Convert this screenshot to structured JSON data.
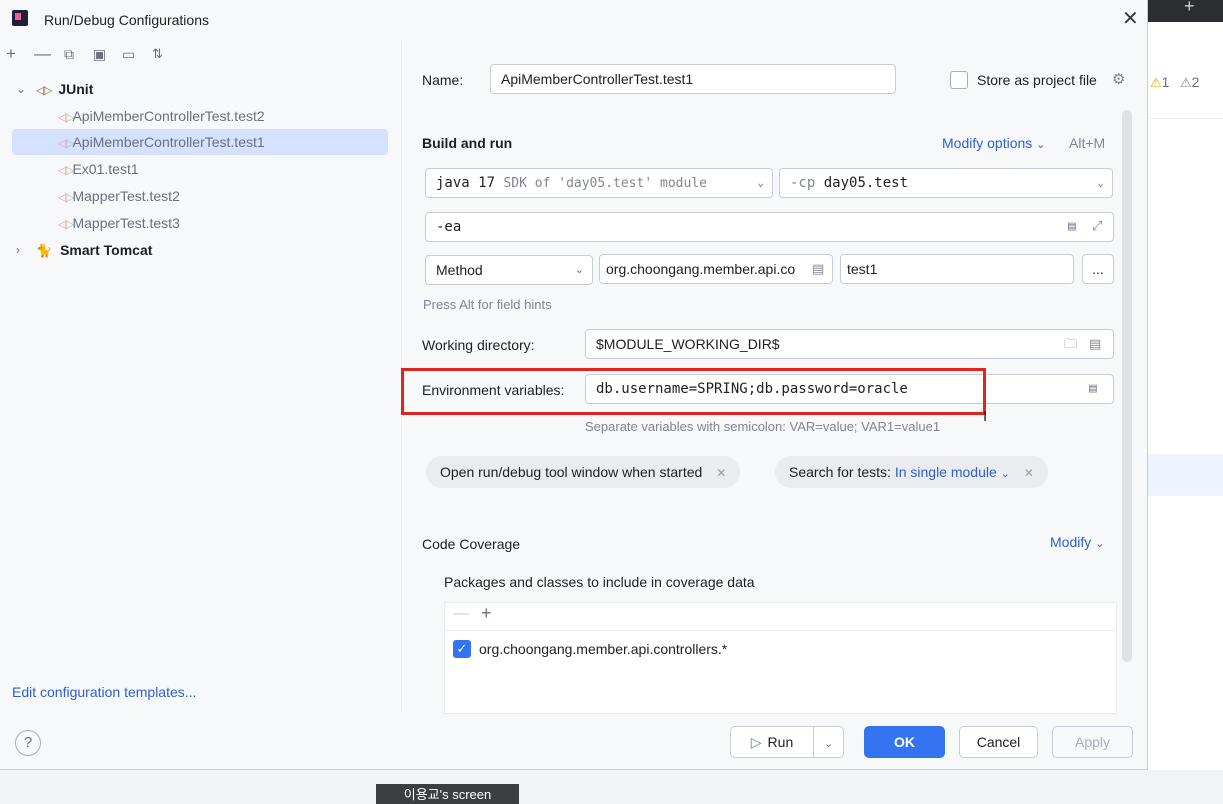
{
  "dialog": {
    "title": "Run/Debug Configurations"
  },
  "tree": {
    "groups": [
      {
        "label": "JUnit",
        "children": [
          "ApiMemberControllerTest.test2",
          "ApiMemberControllerTest.test1",
          "Ex01.test1",
          "MapperTest.test2",
          "MapperTest.test3"
        ]
      },
      {
        "label": "Smart Tomcat"
      }
    ],
    "edit_templates": "Edit configuration templates..."
  },
  "form": {
    "name_label": "Name:",
    "name_value": "ApiMemberControllerTest.test1",
    "store_label": "Store as project file",
    "build_run_label": "Build and run",
    "modify_options": "Modify options",
    "modify_shortcut": "Alt+M",
    "jdk_value": "java 17",
    "jdk_hint": "SDK of 'day05.test' module",
    "cp_prefix": "-cp",
    "cp_value": "day05.test",
    "vm_options": "-ea",
    "test_kind": "Method",
    "class_value": "org.choongang.member.api.co",
    "method_value": "test1",
    "more_button": "...",
    "field_hint": "Press Alt for field hints",
    "working_dir_label": "Working directory:",
    "working_dir_value": "$MODULE_WORKING_DIR$",
    "env_label": "Environment variables:",
    "env_value": "db.username=SPRING;db.password=oracle",
    "env_hint": "Separate variables with semicolon: VAR=value; VAR1=value1",
    "chip_open_tool_window": "Open run/debug tool window when started",
    "chip_search_label": "Search for tests:",
    "chip_search_value": "In single module",
    "coverage_label": "Code Coverage",
    "coverage_modify": "Modify",
    "coverage_packages_label": "Packages and classes to include in coverage data",
    "coverage_item": "org.choongang.member.api.controllers.*"
  },
  "buttons": {
    "help": "?",
    "run": "Run",
    "ok": "OK",
    "cancel": "Cancel",
    "apply": "Apply"
  },
  "background": {
    "warn1": "1",
    "warn2": "2",
    "screen_tag": "이용교's screen"
  },
  "colors": {
    "accent": "#3574f0",
    "highlight_box": "#e0241f",
    "link": "#2d5fd1"
  }
}
